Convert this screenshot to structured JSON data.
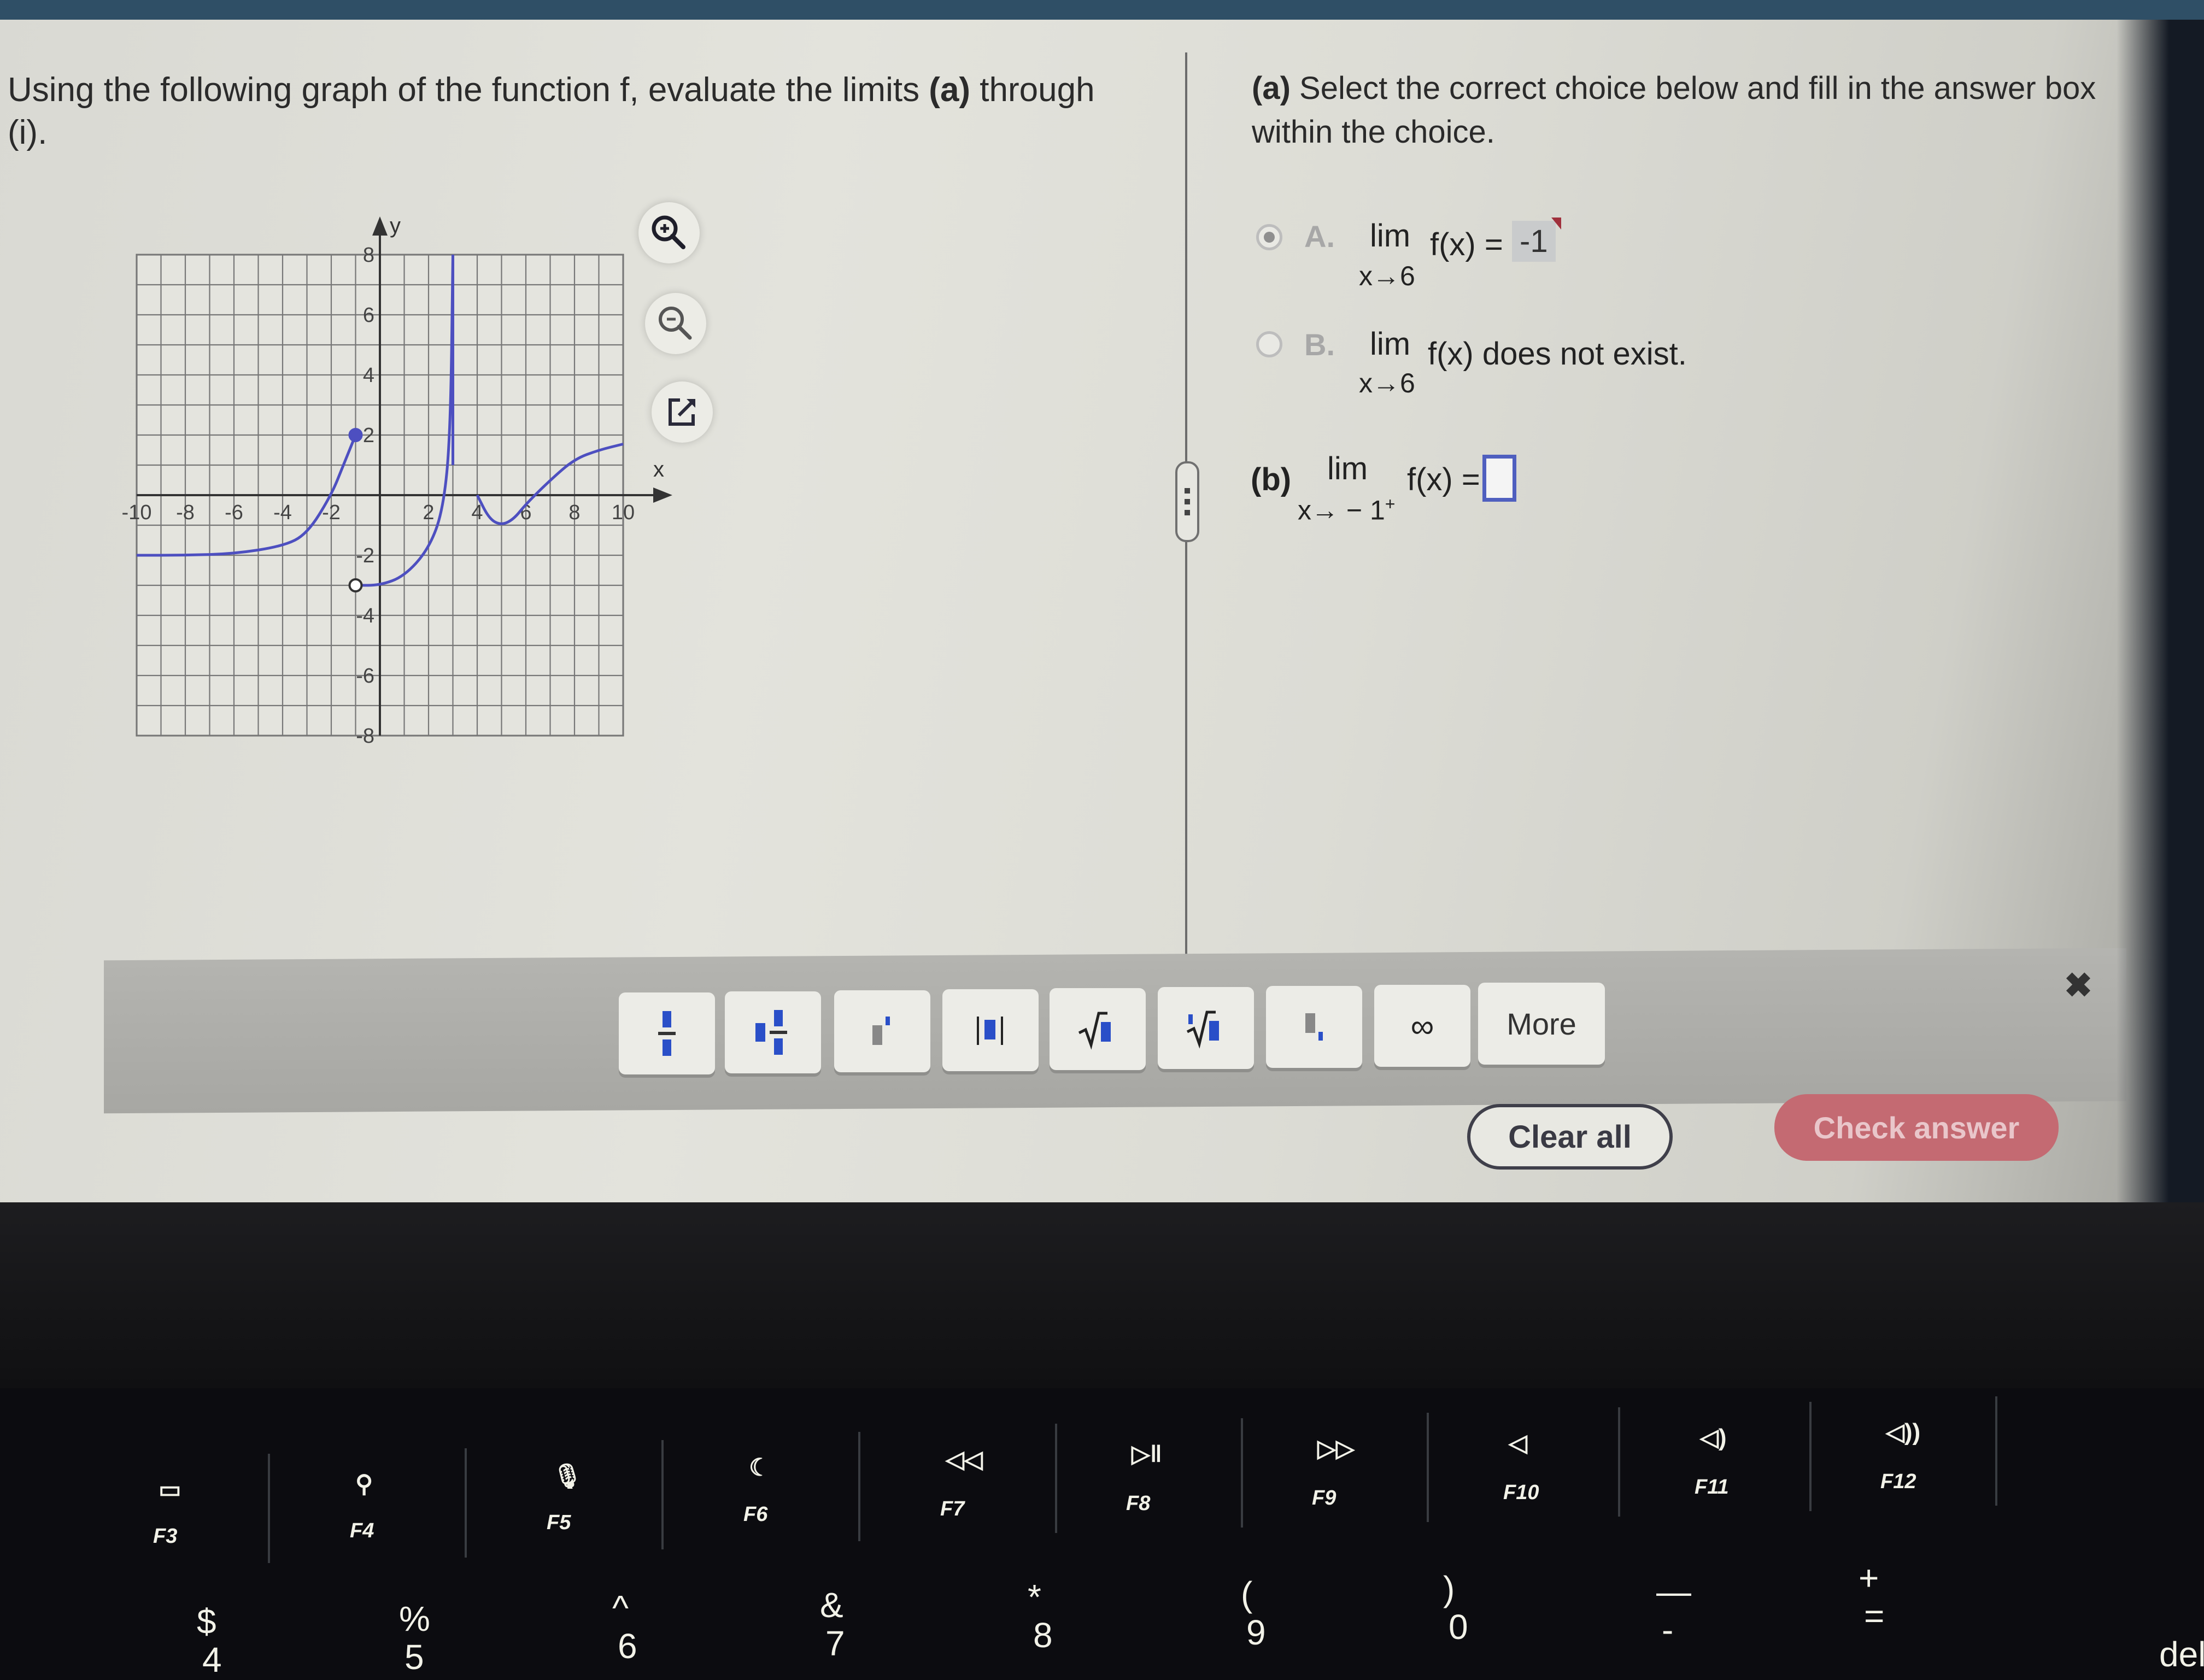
{
  "question": {
    "prompt_part1": "Using the following graph of the function f, evaluate the limits ",
    "prompt_bold_a": "(a)",
    "prompt_part2": " through",
    "prompt_line2": "(i)."
  },
  "graph_tools": {
    "zoom_in": "zoom-in",
    "zoom_out": "zoom-out",
    "popout": "open-in-new-window"
  },
  "chart_data": {
    "type": "line",
    "title": "",
    "xlabel": "x",
    "ylabel": "y",
    "xlim": [
      -10,
      10
    ],
    "ylim": [
      -8,
      8
    ],
    "grid": true,
    "x_ticks": [
      "-10",
      "-8",
      "-6",
      "-4",
      "-2",
      "2",
      "4",
      "6",
      "8",
      "10"
    ],
    "y_ticks": [
      "8",
      "6",
      "4",
      "2",
      "-2",
      "-4",
      "-6",
      "-8"
    ],
    "series": [
      {
        "name": "f-piece-1",
        "points": [
          [
            -10,
            -2
          ],
          [
            -8,
            -2
          ],
          [
            -6,
            -1.95
          ],
          [
            -4,
            -1.7
          ],
          [
            -3,
            -1.3
          ],
          [
            -2,
            0
          ],
          [
            -1.5,
            1
          ],
          [
            -1,
            2
          ]
        ],
        "end_point": {
          "x": -1,
          "y": 2,
          "style": "closed"
        }
      },
      {
        "name": "f-piece-2",
        "points": [
          [
            -1,
            -3
          ],
          [
            0,
            -3
          ],
          [
            1,
            -2.7
          ],
          [
            2,
            -1.8
          ],
          [
            2.6,
            -0.5
          ],
          [
            2.9,
            2
          ],
          [
            3,
            8
          ]
        ],
        "start_point": {
          "x": -1,
          "y": -3,
          "style": "open"
        },
        "vertical_asymptote": 3
      },
      {
        "name": "f-piece-3",
        "points": [
          [
            4,
            0
          ],
          [
            4.5,
            -0.8
          ],
          [
            5,
            -1
          ],
          [
            5.5,
            -0.8
          ],
          [
            6,
            -0.3
          ],
          [
            7,
            0.5
          ],
          [
            8,
            1.2
          ],
          [
            9,
            1.5
          ],
          [
            10,
            1.7
          ]
        ]
      }
    ]
  },
  "part_a": {
    "instructions_bold": "(a)",
    "instructions": " Select the correct choice below and fill in the answer box within the choice.",
    "choice_a": {
      "letter": "A.",
      "lim": "lim",
      "sub": "x→6",
      "expr": "f(x) =",
      "answer": "-1",
      "selected": true
    },
    "choice_b": {
      "letter": "B.",
      "lim": "lim",
      "sub": "x→6",
      "expr": "f(x) does not exist.",
      "selected": false
    }
  },
  "part_b": {
    "label": "(b)",
    "lim": "lim",
    "sub": "x→ − 1",
    "sub_sup": "+",
    "expr": "f(x) =",
    "answer": ""
  },
  "toolbar": {
    "buttons": [
      {
        "name": "fraction",
        "icon": "fraction-icon"
      },
      {
        "name": "mixed-number",
        "icon": "mixed-number-icon"
      },
      {
        "name": "exponent",
        "icon": "exponent-icon"
      },
      {
        "name": "absolute-value",
        "icon": "absolute-value-icon"
      },
      {
        "name": "square-root",
        "icon": "sqrt-icon"
      },
      {
        "name": "nth-root",
        "icon": "nth-root-icon"
      },
      {
        "name": "subscript",
        "icon": "subscript-icon"
      },
      {
        "name": "infinity",
        "icon": "infinity-icon",
        "glyph": "∞"
      }
    ],
    "more_label": "More",
    "close_glyph": "✖"
  },
  "actions": {
    "clear_all": "Clear all",
    "check_answer": "Check answer"
  },
  "keyboard": {
    "fn_row": [
      {
        "label": "F3",
        "icon": "mission-control-icon"
      },
      {
        "label": "F4",
        "icon": "search-icon"
      },
      {
        "label": "F5",
        "icon": "microphone-icon"
      },
      {
        "label": "F6",
        "icon": "moon-icon"
      },
      {
        "label": "F7",
        "icon": "rewind-icon"
      },
      {
        "label": "F8",
        "icon": "play-pause-icon"
      },
      {
        "label": "F9",
        "icon": "fast-forward-icon"
      },
      {
        "label": "F10",
        "icon": "mute-icon"
      },
      {
        "label": "F11",
        "icon": "volume-down-icon"
      },
      {
        "label": "F12",
        "icon": "volume-up-icon"
      }
    ],
    "number_row": [
      {
        "top": "$",
        "bottom": "4"
      },
      {
        "top": "%",
        "bottom": "5"
      },
      {
        "top": "^",
        "bottom": "6"
      },
      {
        "top": "&",
        "bottom": "7"
      },
      {
        "top": "*",
        "bottom": "8"
      },
      {
        "top": "(",
        "bottom": "9"
      },
      {
        "top": ")",
        "bottom": "0"
      },
      {
        "top": "—",
        "bottom": "-"
      },
      {
        "top": "+",
        "bottom": "="
      },
      {
        "top": "",
        "bottom": "delete"
      }
    ]
  },
  "colors": {
    "curve": "#4d4fc0",
    "answer_box_border": "#4f5fbf",
    "check_button": "#c46a72",
    "screen_top_bar": "#2f4f66"
  }
}
